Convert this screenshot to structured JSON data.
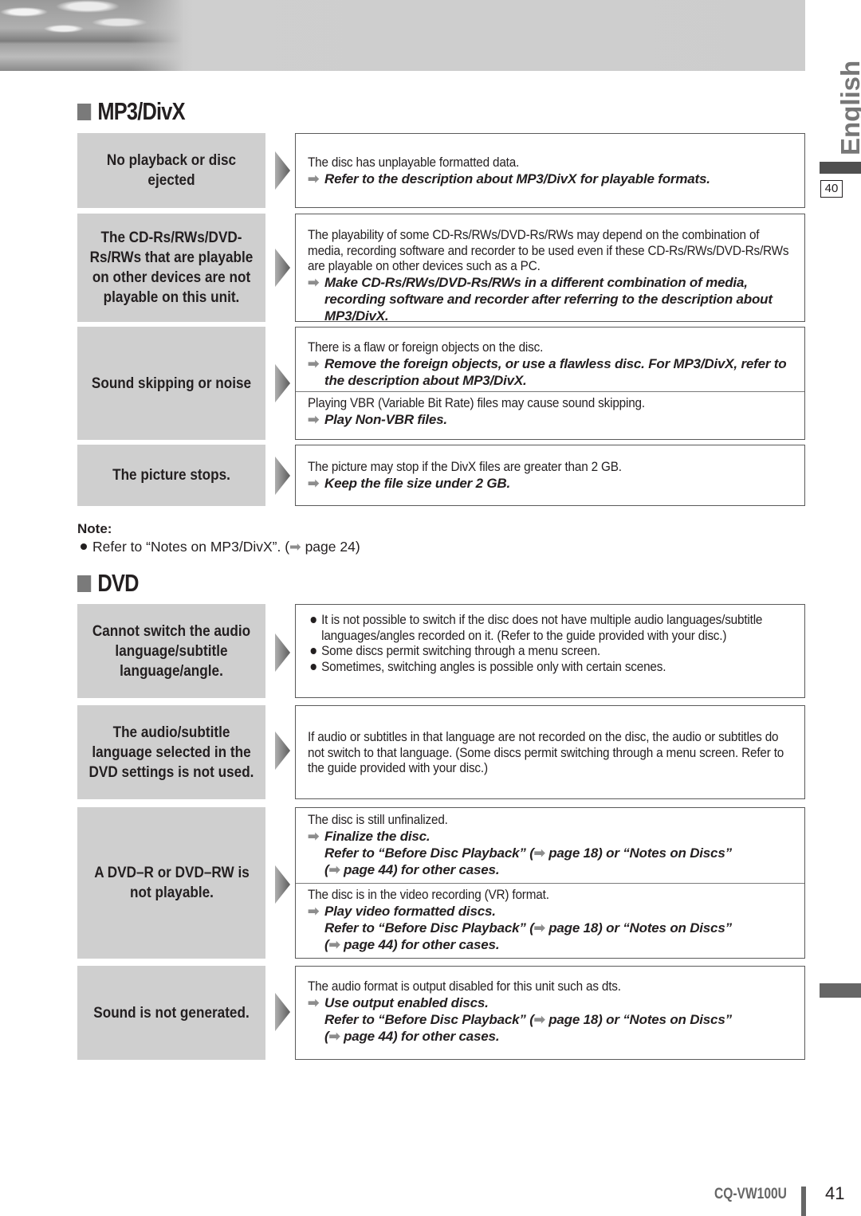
{
  "header": {
    "banner": "landscape-header-image"
  },
  "side_tab": {
    "language": "English",
    "section_page": "40"
  },
  "sections": [
    {
      "title": "MP3/DivX",
      "rows": [
        {
          "symptom": "No playback or disc ejected",
          "cells": [
            {
              "cause": "The disc has unplayable formatted data.",
              "fix": [
                "Refer to the description about MP3/DivX for playable formats."
              ]
            }
          ]
        },
        {
          "symptom": "The CD-Rs/RWs/DVD-Rs/RWs that are playable on other devices are not playable on this unit.",
          "cells": [
            {
              "cause": "The playability of some CD-Rs/RWs/DVD-Rs/RWs may depend on the combination of media, recording software and recorder to be used even if these CD-Rs/RWs/DVD-Rs/RWs are playable on other devices such as a PC.",
              "fix": [
                "Make CD-Rs/RWs/DVD-Rs/RWs in a different combination of media, recording software and recorder after referring to the description about MP3/DivX."
              ]
            }
          ]
        },
        {
          "symptom": "Sound skipping or noise",
          "cells": [
            {
              "cause": "There is a flaw or foreign objects on the disc.",
              "fix": [
                "Remove the foreign objects, or use a flawless disc. For MP3/DivX, refer to the description about MP3/DivX."
              ]
            },
            {
              "cause": "Playing VBR (Variable Bit Rate) files may cause sound skipping.",
              "fix": [
                "Play Non-VBR files."
              ]
            }
          ]
        },
        {
          "symptom": "The picture stops.",
          "cells": [
            {
              "cause": "The picture may stop if the DivX files are greater than 2 GB.",
              "fix": [
                "Keep the file size under 2 GB."
              ]
            }
          ]
        }
      ],
      "note": {
        "label": "Note:",
        "item": "Refer to “Notes on MP3/DivX”. (",
        "item_page": " page 24)"
      }
    },
    {
      "title": "DVD",
      "rows": [
        {
          "symptom": "Cannot switch the audio language/subtitle language/angle.",
          "bullets": [
            "It is not possible to switch if the disc does not have multiple audio languages/subtitle languages/angles recorded on it. (Refer to the guide provided with your disc.)",
            "Some discs permit switching through a menu screen.",
            "Sometimes, switching angles is possible only with certain scenes."
          ]
        },
        {
          "symptom": "The audio/subtitle language selected in the DVD settings is not used.",
          "cells": [
            {
              "cause": "If audio or subtitles in that language are not recorded on the disc, the audio or subtitles do not switch to that language. (Some discs permit switching through a menu screen. Refer to the guide provided with your disc.)",
              "fix": []
            }
          ]
        },
        {
          "symptom": "A DVD–R or DVD–RW is not playable.",
          "cells": [
            {
              "cause": "The disc is still unfinalized.",
              "fix": [
                "Finalize the disc."
              ],
              "ref": {
                "a": "Refer to “Before Disc Playback” (",
                "b": " page 18) or “Notes on Discs”",
                "c": "(",
                "d": " page 44) for other cases."
              }
            },
            {
              "cause": "The disc is in the video recording (VR) format.",
              "fix": [
                "Play video formatted discs."
              ],
              "ref": {
                "a": "Refer to “Before Disc Playback” (",
                "b": " page 18) or “Notes on Discs”",
                "c": "(",
                "d": " page 44) for other cases."
              }
            }
          ]
        },
        {
          "symptom": "Sound is not generated.",
          "cells": [
            {
              "cause": "The audio format is output disabled for this unit such as dts.",
              "fix": [
                "Use output enabled discs."
              ],
              "ref": {
                "a": "Refer to “Before Disc Playback” (",
                "b": " page 18) or “Notes on Discs”",
                "c": "(",
                "d": " page 44) for other cases."
              }
            }
          ]
        }
      ]
    }
  ],
  "footer": {
    "model": "CQ-VW100U",
    "page": "41"
  },
  "icons": {
    "arrow": "➡"
  }
}
